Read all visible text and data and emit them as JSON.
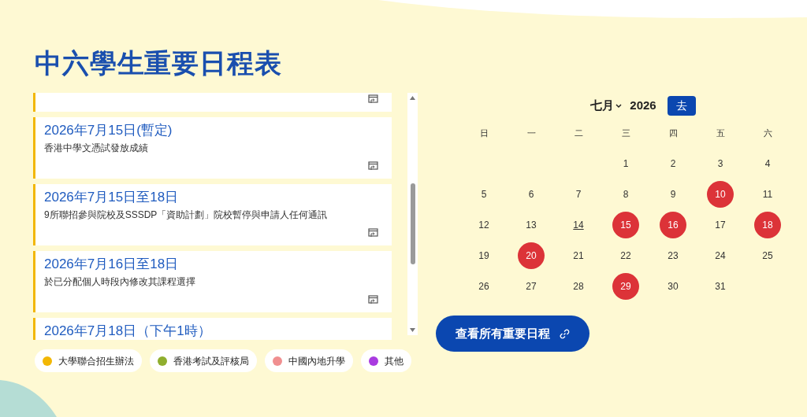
{
  "title": "中六學生重要日程表",
  "events": [
    {
      "kind": "clipped",
      "color": "#f2b705"
    },
    {
      "kind": "full",
      "color": "#f2b705",
      "date": "2026年7月15日(暫定)",
      "description": "香港中學文憑試發放成績"
    },
    {
      "kind": "full",
      "color": "#f2b705",
      "date": "2026年7月15日至18日",
      "description": "9所聯招參與院校及SSSDP「資助計劃」院校暫停與申請人任何通訊"
    },
    {
      "kind": "full",
      "color": "#f2b705",
      "date": "2026年7月16日至18日",
      "description": "於已分配個人時段內修改其課程選擇"
    },
    {
      "kind": "cut",
      "color": "#f2b705",
      "date": "2026年7月18日（下午1時）"
    }
  ],
  "calendar": {
    "month": "七月",
    "year": "2026",
    "go_button": "去",
    "weekdays": [
      "日",
      "一",
      "二",
      "三",
      "四",
      "五",
      "六"
    ],
    "weeks": [
      {
        "days": [
          {
            "kind": "blank"
          },
          {
            "kind": "blank"
          },
          {
            "kind": "blank"
          },
          {
            "kind": "day",
            "day": "1",
            "highlighted": false,
            "today": false
          },
          {
            "kind": "day",
            "day": "2",
            "highlighted": false,
            "today": false
          },
          {
            "kind": "day",
            "day": "3",
            "highlighted": false,
            "today": false
          },
          {
            "kind": "day",
            "day": "4",
            "highlighted": false,
            "today": false
          }
        ]
      },
      {
        "days": [
          {
            "kind": "day",
            "day": "5",
            "highlighted": false,
            "today": false
          },
          {
            "kind": "day",
            "day": "6",
            "highlighted": false,
            "today": false
          },
          {
            "kind": "day",
            "day": "7",
            "highlighted": false,
            "today": false
          },
          {
            "kind": "day",
            "day": "8",
            "highlighted": false,
            "today": false
          },
          {
            "kind": "day",
            "day": "9",
            "highlighted": false,
            "today": false
          },
          {
            "kind": "day",
            "day": "10",
            "highlighted": true,
            "today": false
          },
          {
            "kind": "day",
            "day": "11",
            "highlighted": false,
            "today": false
          }
        ]
      },
      {
        "days": [
          {
            "kind": "day",
            "day": "12",
            "highlighted": false,
            "today": false
          },
          {
            "kind": "day",
            "day": "13",
            "highlighted": false,
            "today": false
          },
          {
            "kind": "day",
            "day": "14",
            "highlighted": false,
            "today": true
          },
          {
            "kind": "day",
            "day": "15",
            "highlighted": true,
            "today": false
          },
          {
            "kind": "day",
            "day": "16",
            "highlighted": true,
            "today": false
          },
          {
            "kind": "day",
            "day": "17",
            "highlighted": false,
            "today": false
          },
          {
            "kind": "day",
            "day": "18",
            "highlighted": true,
            "today": false
          }
        ]
      },
      {
        "days": [
          {
            "kind": "day",
            "day": "19",
            "highlighted": false,
            "today": false
          },
          {
            "kind": "day",
            "day": "20",
            "highlighted": true,
            "today": false
          },
          {
            "kind": "day",
            "day": "21",
            "highlighted": false,
            "today": false
          },
          {
            "kind": "day",
            "day": "22",
            "highlighted": false,
            "today": false
          },
          {
            "kind": "day",
            "day": "23",
            "highlighted": false,
            "today": false
          },
          {
            "kind": "day",
            "day": "24",
            "highlighted": false,
            "today": false
          },
          {
            "kind": "day",
            "day": "25",
            "highlighted": false,
            "today": false
          }
        ]
      },
      {
        "days": [
          {
            "kind": "day",
            "day": "26",
            "highlighted": false,
            "today": false
          },
          {
            "kind": "day",
            "day": "27",
            "highlighted": false,
            "today": false
          },
          {
            "kind": "day",
            "day": "28",
            "highlighted": false,
            "today": false
          },
          {
            "kind": "day",
            "day": "29",
            "highlighted": true,
            "today": false
          },
          {
            "kind": "day",
            "day": "30",
            "highlighted": false,
            "today": false
          },
          {
            "kind": "day",
            "day": "31",
            "highlighted": false,
            "today": false
          },
          {
            "kind": "blank"
          }
        ]
      }
    ]
  },
  "legend": [
    {
      "label": "大學聯合招生辦法",
      "color": "#f2b705"
    },
    {
      "label": "香港考試及評核局",
      "color": "#8fae2e"
    },
    {
      "label": "中國內地升學",
      "color": "#f08f90"
    },
    {
      "label": "其他",
      "color": "#a93be0"
    }
  ],
  "view_all_button": "查看所有重要日程"
}
